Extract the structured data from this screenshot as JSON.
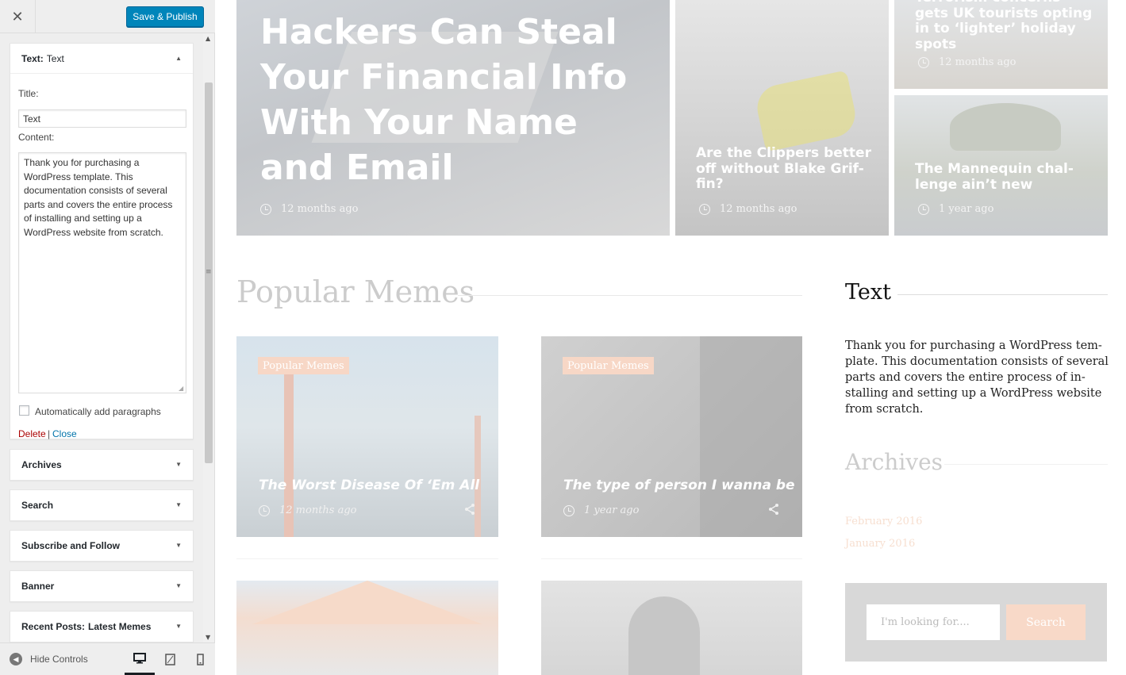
{
  "customizer": {
    "close_glyph": "✕",
    "publish_label": "Save & Publish",
    "text_widget": {
      "type_label": "Text:",
      "title_suffix": "Text",
      "title_label": "Title:",
      "title_value": "Text",
      "content_label": "Content:",
      "content_value": "Thank you for purchasing a WordPress template. This documentation consists of several parts and covers the entire process of installing and setting up a WordPress website from scratch.",
      "auto_paragraphs_label": "Automatically add paragraphs",
      "delete_label": "Delete",
      "separator": "|",
      "close_label": "Close"
    },
    "widgets": [
      {
        "label": "Archives",
        "suffix": ""
      },
      {
        "label": "Search",
        "suffix": ""
      },
      {
        "label": "Subscribe and Follow",
        "suffix": ""
      },
      {
        "label": "Banner",
        "suffix": ""
      },
      {
        "label": "Recent Posts:",
        "suffix": "Latest Memes"
      }
    ],
    "footer": {
      "hide_controls_label": "Hide Controls"
    }
  },
  "preview": {
    "hero_main": {
      "title": "Hackers Can Steal Your Financial Info With Your Name and Email",
      "meta": "12 months ago"
    },
    "hero_middle": {
      "title": "Are the Clippers better off without Blake Grif-fin?",
      "meta": "12 months ago"
    },
    "hero_top_right": {
      "title": "Terrorism concerns gets UK tourists opting in to ‘lighter’ holiday spots",
      "meta": "12 months ago"
    },
    "hero_bottom_right": {
      "title": "The Mannequin chal-lenge ain’t new",
      "meta": "1 year ago"
    },
    "popular_title": "Popular Memes",
    "cards": [
      {
        "badge": "Popular Memes",
        "title": "The Worst Disease Of ‘Em All",
        "meta": "12 months ago"
      },
      {
        "badge": "Popular Memes",
        "title": "The type of person I wanna be",
        "meta": "1 year ago"
      }
    ],
    "sidebar_text_title": "Text",
    "sidebar_text_body": "Thank you for purchasing a WordPress tem-plate. This documentation consists of several parts and covers the entire process of in-stalling and setting up a WordPress website from scratch.",
    "archives_title": "Archives",
    "archives": [
      "February 2016",
      "January 2016"
    ],
    "search_placeholder": "I'm looking for....",
    "search_button": "Search"
  },
  "colors": {
    "publish_bg": "#0085ba",
    "delete": "#aa0000",
    "link": "#0073aa",
    "badge": "#f7d7c6"
  }
}
